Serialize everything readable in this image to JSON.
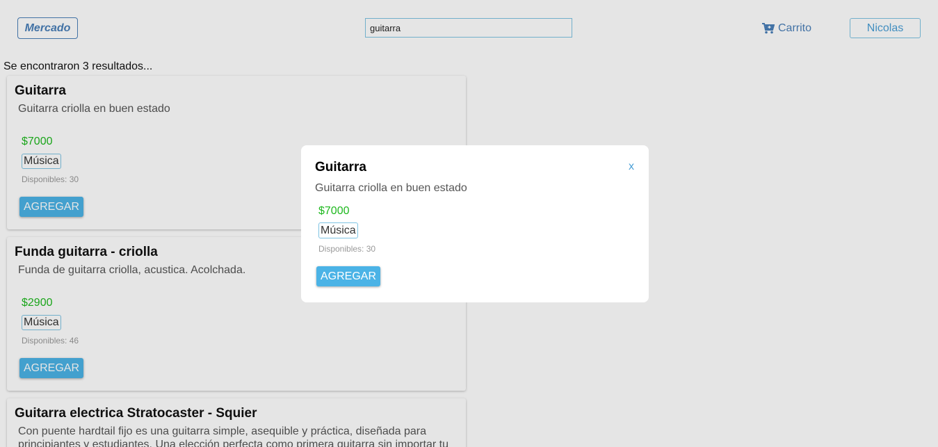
{
  "header": {
    "logo": "Mercado",
    "search_value": "guitarra",
    "cart_label": "Carrito",
    "user_label": "Nicolas"
  },
  "results_text": "Se encontraron 3 resultados...",
  "products": [
    {
      "title": "Guitarra",
      "description": "Guitarra criolla en buen estado",
      "price": "$7000",
      "category": "Música",
      "stock": "Disponibles: 30",
      "button": "AGREGAR"
    },
    {
      "title": "Funda guitarra - criolla",
      "description": "Funda de guitarra criolla, acustica. Acolchada.",
      "price": "$2900",
      "category": "Música",
      "stock": "Disponibles: 46",
      "button": "AGREGAR"
    },
    {
      "title": "Guitarra electrica Stratocaster - Squier",
      "description": "Con puente hardtail fijo es una guitarra simple, asequible y práctica, diseñada para principiantes y estudiantes. Una elección perfecta como primera guitarra sin importar tu"
    }
  ],
  "modal": {
    "title": "Guitarra",
    "close": "x",
    "description": "Guitarra criolla en buen estado",
    "price": "$7000",
    "category": "Música",
    "stock": "Disponibles: 30",
    "button": "AGREGAR"
  }
}
